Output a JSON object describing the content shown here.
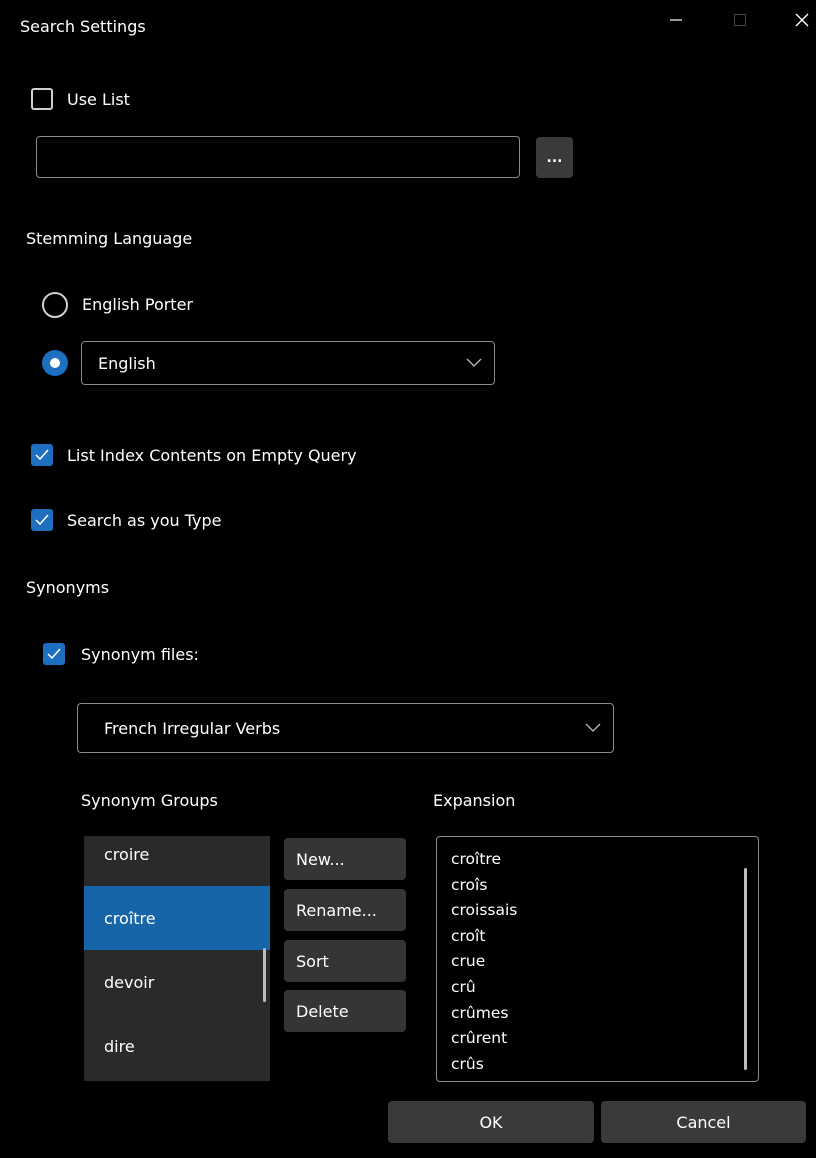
{
  "window": {
    "title": "Search Settings"
  },
  "use_list": {
    "label": "Use List",
    "checked": false,
    "path_value": "",
    "browse_label": "..."
  },
  "stemming": {
    "heading": "Stemming Language",
    "option_porter": "English Porter",
    "selected_language": "English"
  },
  "options": {
    "list_index": {
      "label": "List Index Contents on Empty Query",
      "checked": true
    },
    "search_as_type": {
      "label": "Search as you Type",
      "checked": true
    }
  },
  "synonyms": {
    "heading": "Synonyms",
    "files_label": "Synonym files:",
    "files_checked": true,
    "selected_file": "French Irregular Verbs",
    "groups_heading": "Synonym Groups",
    "expansion_heading": "Expansion",
    "groups": [
      "croire",
      "croître",
      "devoir",
      "dire"
    ],
    "selected_group": "croître",
    "buttons": {
      "new": "New...",
      "rename": "Rename...",
      "sort": "Sort",
      "delete": "Delete"
    },
    "expansion": [
      "croître",
      "croîs",
      "croissais",
      "croît",
      "crue",
      "crû",
      "crûmes",
      "crûrent",
      "crûs"
    ]
  },
  "footer": {
    "ok": "OK",
    "cancel": "Cancel"
  },
  "colors": {
    "accent": "#1f6fc1",
    "selected_row": "#1565a8",
    "background": "#000000"
  }
}
